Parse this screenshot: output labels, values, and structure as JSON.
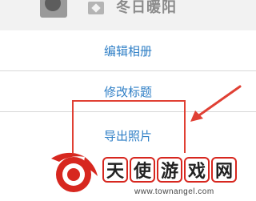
{
  "header": {
    "username": "冬日暖阳",
    "avatar_icon": "avatar",
    "badge_icon": "vip-badge-icon"
  },
  "menu": {
    "items": [
      {
        "label": "编辑相册"
      },
      {
        "label": "修改标题"
      },
      {
        "label": "导出照片"
      }
    ]
  },
  "annotation": {
    "highlight_color": "#e04034",
    "arrow_color": "#e04034"
  },
  "watermark": {
    "chars": [
      "天",
      "使",
      "游",
      "戏",
      "网"
    ],
    "url": "www.townangel.com",
    "brand_color": "#d7271f"
  },
  "colors": {
    "menu_text": "#2f7fc6",
    "background": "#e6e6e6"
  }
}
